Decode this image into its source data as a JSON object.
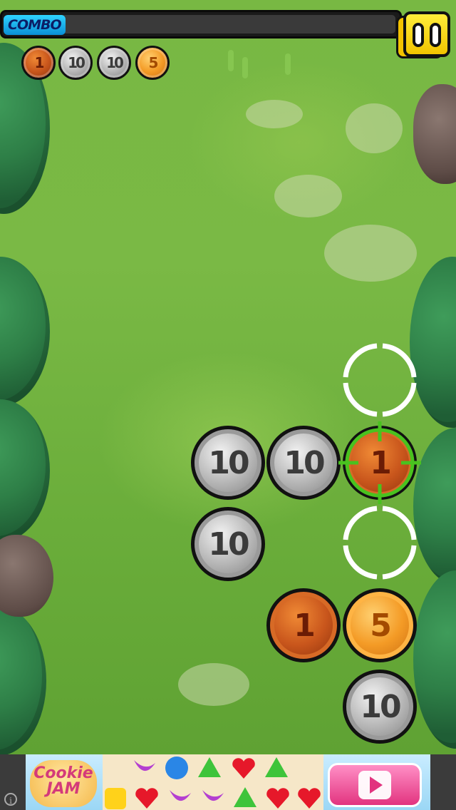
{
  "hud": {
    "combo_label": "COMBO",
    "combo_progress": 0,
    "queue": [
      {
        "value": "1",
        "kind": "copper"
      },
      {
        "value": "10",
        "kind": "silver"
      },
      {
        "value": "10",
        "kind": "silver"
      },
      {
        "value": "5",
        "kind": "gold"
      }
    ],
    "pause_icon": "pause-icon"
  },
  "board": {
    "coins": [
      {
        "value": "10",
        "kind": "silver"
      },
      {
        "value": "10",
        "kind": "silver"
      },
      {
        "value": "1",
        "kind": "copper",
        "selected": true
      },
      {
        "value": "10",
        "kind": "silver"
      },
      {
        "value": "1",
        "kind": "copper"
      },
      {
        "value": "5",
        "kind": "gold"
      },
      {
        "value": "10",
        "kind": "silver"
      }
    ]
  },
  "ad": {
    "brand_line1": "Cookie",
    "brand_line2": "JAM",
    "play_icon": "play-icon",
    "info_icon": "info-icon",
    "info_text": "i"
  },
  "colors": {
    "copper": "#c9561c",
    "silver": "#bdbdbd",
    "gold": "#f49b26",
    "combo_label": "#1bb7f0",
    "pause_button": "#f2c400",
    "target_green": "#49c21f"
  }
}
